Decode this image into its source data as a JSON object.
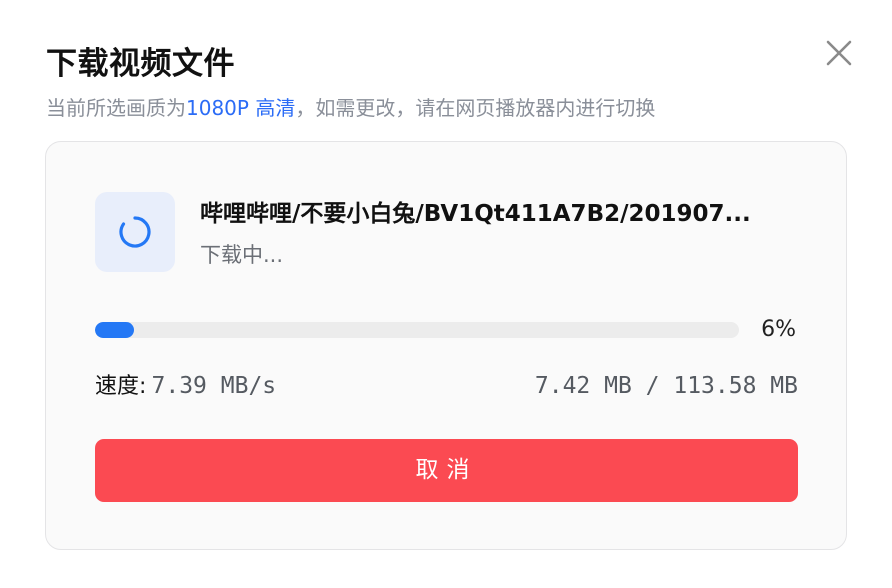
{
  "dialog": {
    "title": "下载视频文件",
    "subtitle_before": "当前所选画质为",
    "subtitle_quality": "1080P 高清",
    "subtitle_after": "，如需更改，请在网页播放器内进行切换",
    "close_icon": "close-icon"
  },
  "download": {
    "file_name": "哔哩哔哩/不要小白兔/BV1Qt411A7B2/201907...",
    "status": "下载中...",
    "status_icon": "loading-spinner-icon",
    "progress_percent": 6,
    "progress_label": "6%",
    "speed_label": "速度:",
    "speed_value": "7.39 MB/s",
    "size_value": "7.42 MB / 113.58 MB"
  },
  "actions": {
    "cancel_label": "取消"
  },
  "colors": {
    "accent": "#2478f5",
    "link": "#2b6cf6",
    "danger": "#fb4a52"
  }
}
